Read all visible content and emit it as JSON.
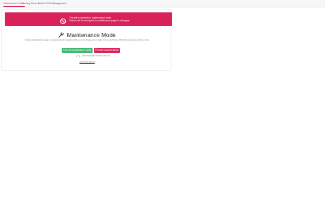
{
  "tabs": [
    {
      "label": "Maintenance Mode",
      "active": true
    },
    {
      "label": "Coming Soon & ",
      "active": false
    },
    {
      "label": "Multi & SSL Management",
      "active": false
    }
  ],
  "banner": {
    "line1": "The site is currently in maintenance mode.",
    "line2": "Visitors will be seeing the in maintenance page for all pages.",
    "icon": "block-icon",
    "color": "#d9225a"
  },
  "main": {
    "title": "Maintenance Mode",
    "title_icon": "wrench-icon",
    "description": "Using a maintenance page on request lets all requests while you can things out so make sure everything is OK before going live with your site.",
    "buttons": {
      "turn_off": "Turn off maintenance mode",
      "preview": "Preview Content Mode"
    },
    "toggle_label": "Allow SearchBot crawls for this site",
    "advanced_link": "Advanced options"
  },
  "colors": {
    "accent": "#d9225a",
    "success": "#3fb872"
  }
}
